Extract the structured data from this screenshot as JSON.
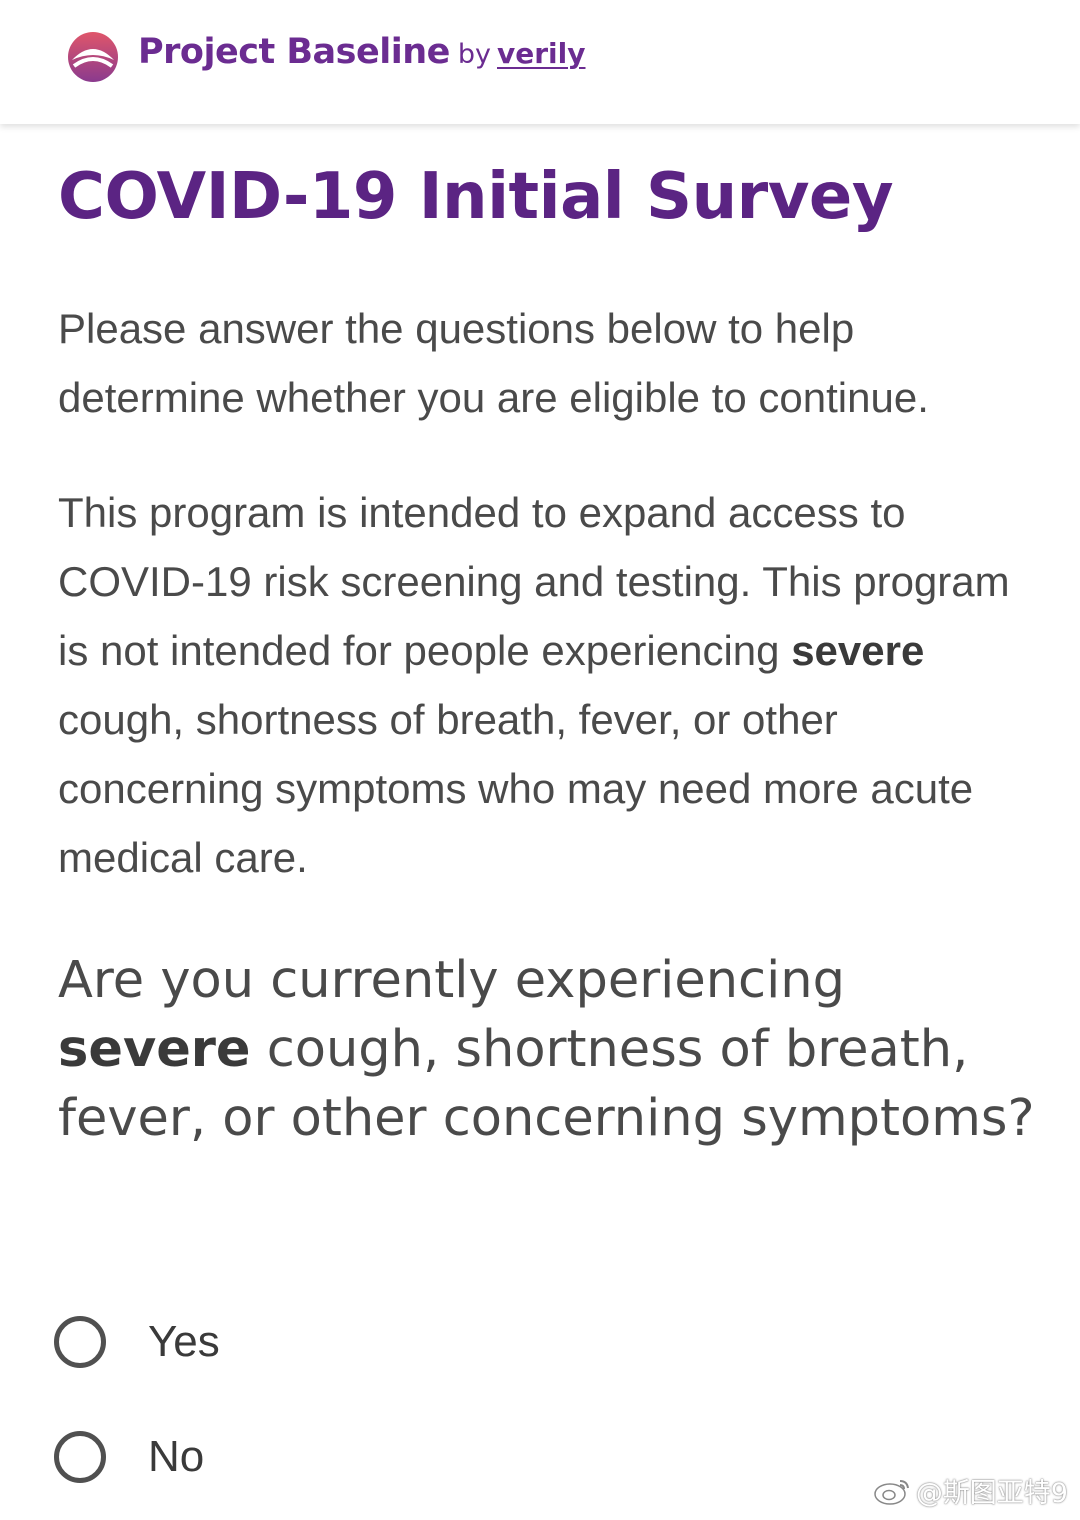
{
  "header": {
    "brand_name": "Project Baseline",
    "brand_by": "by",
    "brand_company": "verily",
    "logo_icon": "project-baseline-logo",
    "brand_color": "#6b2c91"
  },
  "main": {
    "title": "COVID-19 Initial Survey",
    "intro": "Please answer the questions below to help determine whether you are eligible to continue.",
    "notice": {
      "before": "This program is intended to expand access to COVID-19 risk screening and testing. This program is not intended for people experiencing ",
      "emphasis": "severe",
      "after": " cough, shortness of breath, fever, or other concerning symptoms who may need more acute medical care."
    },
    "question": {
      "before": "Are you currently experiencing ",
      "emphasis": "severe",
      "after": " cough, shortness of breath, fever, or other concerning symptoms?"
    },
    "options": [
      {
        "label": "Yes",
        "selected": false
      },
      {
        "label": "No",
        "selected": false
      }
    ],
    "title_color": "#5b2483"
  },
  "watermark": {
    "icon": "weibo-icon",
    "text": "@斯图亚特9"
  }
}
